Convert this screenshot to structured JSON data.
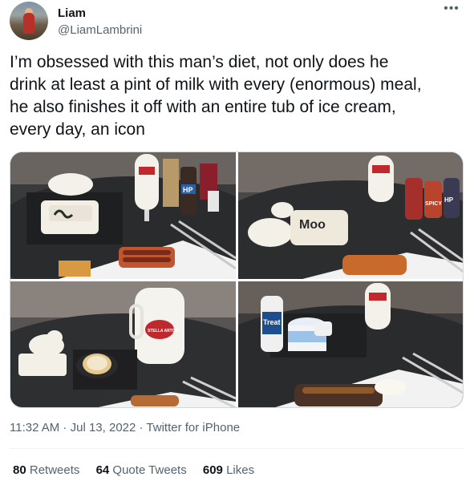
{
  "author": {
    "display_name": "Liam",
    "handle": "@LiamLambrini"
  },
  "tweet": {
    "text": "I’m obsessed with this man’s diet, not only does he\ndrink at least a pint of milk with every (enormous) meal,\nhe also finishes it off with an entire tub of ice cream,\nevery day, an icon"
  },
  "media": {
    "photos": [
      {
        "label": "photo-1",
        "items": [
          "butter dish",
          "bottles",
          "HP sauce",
          "sausages and beans"
        ]
      },
      {
        "label": "photo-2",
        "items": [
          "Moo butter",
          "milk glass",
          "Spicy HP",
          "sausage plate"
        ]
      },
      {
        "label": "photo-3",
        "items": [
          "milk jug",
          "tart",
          "butter dish"
        ]
      },
      {
        "label": "photo-4",
        "items": [
          "Treat",
          "ice cream tub",
          "milk glass"
        ]
      }
    ],
    "visible_text": {
      "hp": "HP",
      "spicy": "SPICY",
      "moo": "Moo",
      "treat": "Treat",
      "stella": "STELLA ARTOIS"
    }
  },
  "meta": {
    "time": "11:32 AM",
    "sep1": " · ",
    "date": "Jul 13, 2022",
    "sep2": " · ",
    "source": "Twitter for iPhone"
  },
  "stats": {
    "retweets_count": "80",
    "retweets_label": "Retweets",
    "quotes_count": "64",
    "quotes_label": "Quote Tweets",
    "likes_count": "609",
    "likes_label": "Likes"
  },
  "icons": {
    "more": "more-options-icon"
  },
  "colors": {
    "text": "#0f1419",
    "secondary": "#536471",
    "border": "#cfd9de"
  }
}
